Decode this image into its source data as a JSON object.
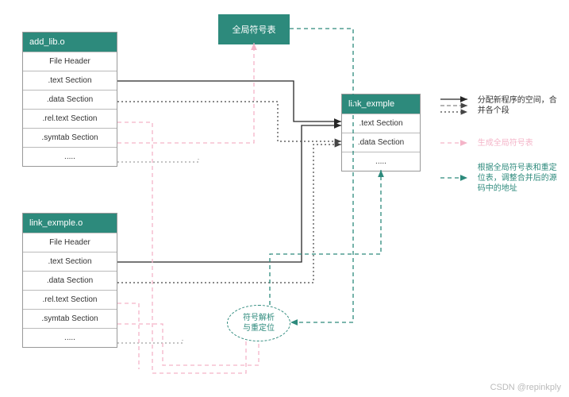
{
  "diagram": {
    "boxes": {
      "obj1": {
        "header": "add_lib.o",
        "rows": [
          "File Header",
          ".text Section",
          ".data Section",
          ".rel.text Section",
          ".symtab Section",
          "....."
        ]
      },
      "obj2": {
        "header": "link_exmple.o",
        "rows": [
          "File Header",
          ".text Section",
          ".data Section",
          ".rel.text Section",
          ".symtab Section",
          "....."
        ]
      },
      "output": {
        "header": "link_exmple",
        "rows": [
          ".text Section",
          ".data Section",
          "....."
        ]
      }
    },
    "global_symbol_table": "全局符号表",
    "ellipse": "符号解析\n与重定位"
  },
  "legend": {
    "entry1": "分配新程序的空间，合并各个段",
    "entry2": "生成全局符号表",
    "entry3": "根据全局符号表和重定位表，调整合并后的源码中的地址"
  },
  "watermark": "CSDN @repinkply",
  "colors": {
    "teal": "#2d8a7c",
    "pink": "#f4b4c8",
    "black": "#262626",
    "gray": "#888"
  }
}
